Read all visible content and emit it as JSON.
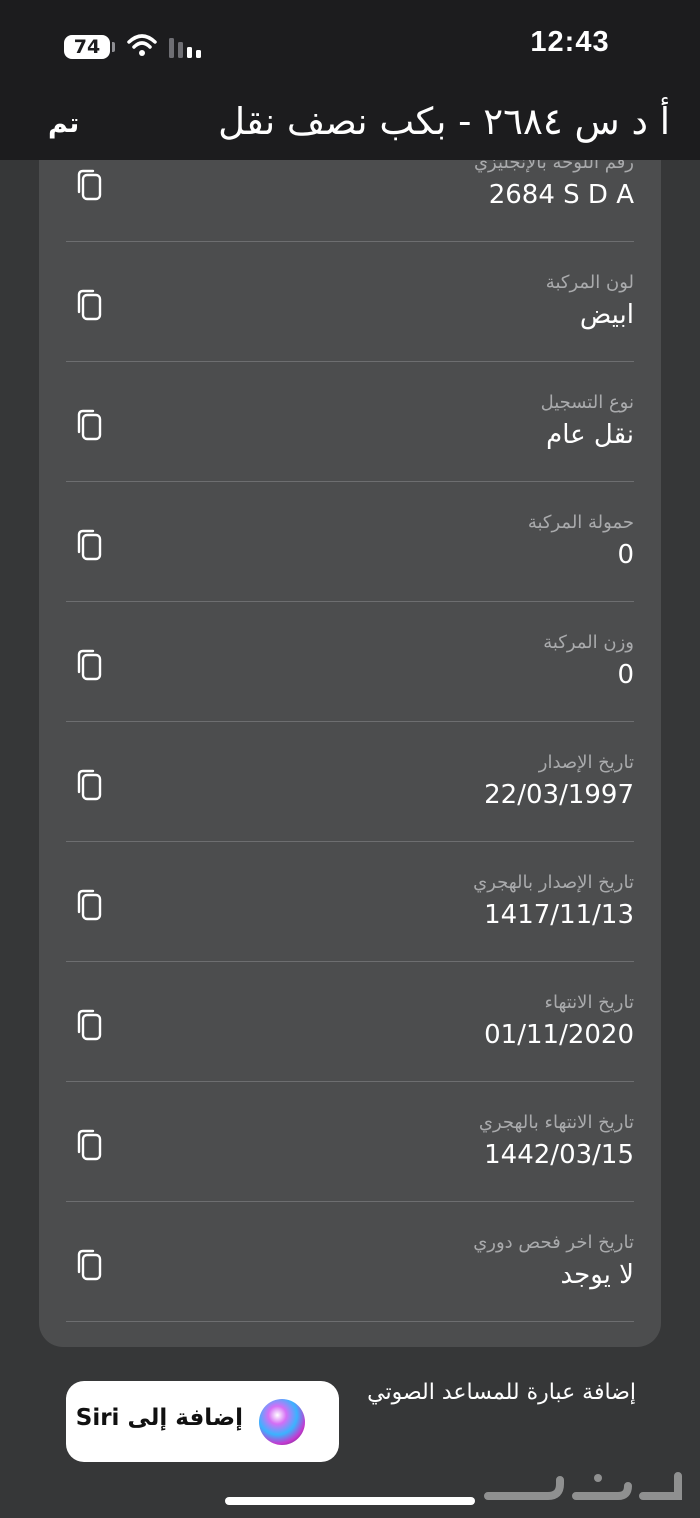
{
  "status_bar": {
    "battery_level": "74",
    "time": "12:43"
  },
  "nav": {
    "title": "أ د س ٢٦٨٤ - بكب نصف نقل",
    "done_label": "تم"
  },
  "details": [
    {
      "label": "رقم اللوحة بالإنجليزي",
      "value": "2684  S D A"
    },
    {
      "label": "لون المركبة",
      "value": "ابيض"
    },
    {
      "label": "نوع التسجيل",
      "value": "نقل عام"
    },
    {
      "label": "حمولة المركبة",
      "value": "0"
    },
    {
      "label": "وزن المركبة",
      "value": "0"
    },
    {
      "label": "تاريخ الإصدار",
      "value": "22/03/1997"
    },
    {
      "label": "تاريخ الإصدار بالهجري",
      "value": "1417/11/13"
    },
    {
      "label": "تاريخ الانتهاء",
      "value": "01/11/2020"
    },
    {
      "label": "تاريخ الانتهاء بالهجري",
      "value": "1442/03/15"
    },
    {
      "label": "تاريخ اخر فحص دوري",
      "value": "لا يوجد"
    }
  ],
  "siri": {
    "section_label": "إضافة عبارة للمساعد الصوتي",
    "button_label": "إضافة إلى Siri"
  },
  "icons": {
    "copy": "copy-icon",
    "wifi": "wifi-icon",
    "signal": "cellular-signal-icon",
    "siri": "siri-icon"
  },
  "colors": {
    "background": "#363738",
    "card": "#4c4d4e",
    "bar": "#1c1c1e",
    "label": "#a9aaac"
  }
}
